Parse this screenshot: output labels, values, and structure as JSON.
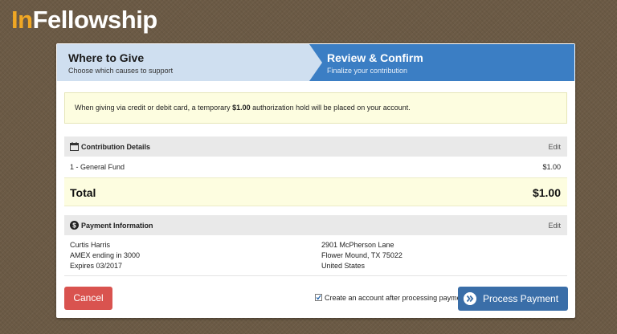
{
  "brand": {
    "logo_prefix": "In",
    "logo_rest": "Fellowship"
  },
  "steps": [
    {
      "title": "Where to Give",
      "subtitle": "Choose which causes to support"
    },
    {
      "title": "Review & Confirm",
      "subtitle": "Finalize your contribution"
    }
  ],
  "notice": {
    "before": "When giving via credit or debit card, a temporary ",
    "amount": "$1.00",
    "after": " authorization hold will be placed on your account."
  },
  "contribution": {
    "heading": "Contribution Details",
    "edit": "Edit",
    "items": [
      {
        "fund": "1 - General Fund",
        "amount": "$1.00"
      }
    ],
    "total_label": "Total",
    "total_amount": "$1.00"
  },
  "payment": {
    "heading": "Payment Information",
    "edit": "Edit",
    "name": "Curtis Harris",
    "card": "AMEX ending in 3000",
    "expires": "Expires 03/2017",
    "address_line1": "2901 McPherson Lane",
    "address_line2": "Flower Mound, TX 75022",
    "country": "United States"
  },
  "actions": {
    "cancel": "Cancel",
    "create_account_label": "Create an account after processing payment",
    "create_account_checked": true,
    "process": "Process Payment"
  },
  "colors": {
    "accent": "#3b7ec4",
    "danger": "#d9534f",
    "highlight": "#fdfde0",
    "brand_orange": "#f0a724"
  }
}
